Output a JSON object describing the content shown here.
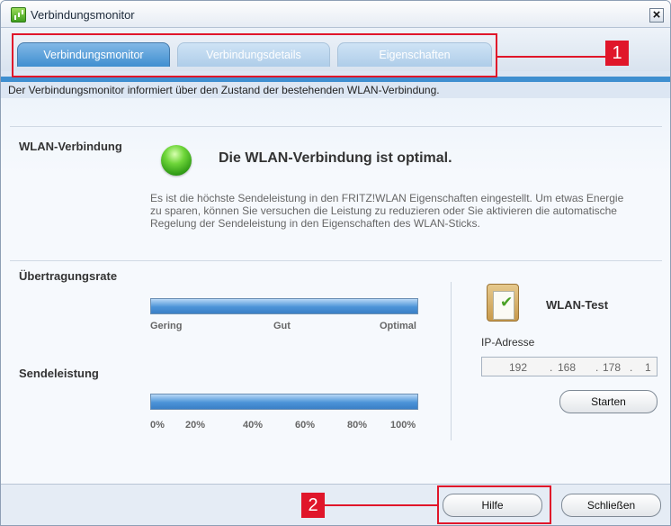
{
  "window": {
    "title": "Verbindungsmonitor",
    "close_glyph": "×"
  },
  "tabs": [
    {
      "label": "Verbindungsmonitor",
      "active": true
    },
    {
      "label": "Verbindungsdetails",
      "active": false
    },
    {
      "label": "Eigenschaften",
      "active": false
    }
  ],
  "callouts": [
    "1",
    "2"
  ],
  "intro_text": "Der Verbindungsmonitor informiert über den Zustand der bestehenden WLAN-Verbindung.",
  "wlan": {
    "section_title": "WLAN-Verbindung",
    "status": "Die WLAN-Verbindung ist optimal.",
    "status_color": "#3fb51e",
    "description": "Es ist die höchste Sendeleistung in den FRITZ!WLAN Eigenschaften eingestellt. Um etwas Energie zu sparen, können Sie versuchen die Leistung zu reduzieren oder Sie aktivieren die automatische Regelung der Sendeleistung in den Eigenschaften des WLAN-Sticks."
  },
  "rate": {
    "section_title": "Übertragungsrate",
    "level": 1.0,
    "labels": [
      "Gering",
      "Gut",
      "Optimal"
    ]
  },
  "power": {
    "section_title": "Sendeleistung",
    "level": 1.0,
    "labels": [
      "0%",
      "20%",
      "40%",
      "60%",
      "80%",
      "100%"
    ]
  },
  "test": {
    "title": "WLAN-Test",
    "ip_label": "IP-Adresse",
    "ip": [
      "192",
      "168",
      "178",
      "1"
    ],
    "start_label": "Starten"
  },
  "footer": {
    "help_label": "Hilfe",
    "close_label": "Schließen"
  },
  "colors": {
    "accent": "#3f8fd0",
    "callout": "#e0162a"
  }
}
